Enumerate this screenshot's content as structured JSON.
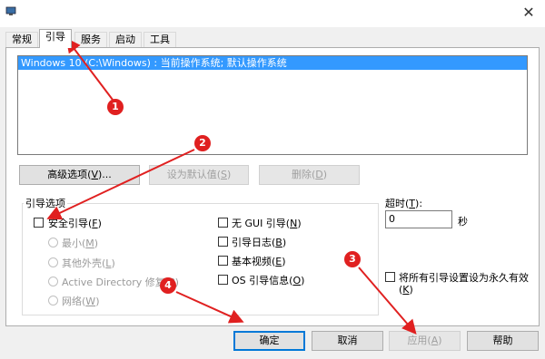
{
  "window": {
    "close_glyph": "✕",
    "app_icon": "system-config-icon"
  },
  "tabs": [
    {
      "label": "常规"
    },
    {
      "label": "引导"
    },
    {
      "label": "服务"
    },
    {
      "label": "启动"
    },
    {
      "label": "工具"
    }
  ],
  "os_list": {
    "selected_entry": "Windows 10 (C:\\Windows) : 当前操作系统; 默认操作系统"
  },
  "buttons": {
    "advanced_prefix": "高级选项(",
    "advanced_key": "V",
    "advanced_suffix": ")...",
    "set_default_prefix": "设为默认值(",
    "set_default_key": "S",
    "set_default_suffix": ")",
    "delete_prefix": "删除(",
    "delete_key": "D",
    "delete_suffix": ")"
  },
  "boot_options": {
    "group_label": "引导选项",
    "safe_boot": {
      "prefix": "安全引导(",
      "key": "F",
      "suffix": ")",
      "checked": false
    },
    "radios": [
      {
        "prefix": "最小(",
        "key": "M",
        "suffix": ")"
      },
      {
        "prefix": "其他外壳(",
        "key": "L",
        "suffix": ")"
      },
      {
        "prefix": "Active Directory 修复(",
        "key": "P",
        "suffix": ")"
      },
      {
        "prefix": "网络(",
        "key": "W",
        "suffix": ")"
      }
    ],
    "right_checks": [
      {
        "prefix": "无 GUI 引导(",
        "key": "N",
        "suffix": ")"
      },
      {
        "prefix": "引导日志(",
        "key": "B",
        "suffix": ")"
      },
      {
        "prefix": "基本视频(",
        "key": "E",
        "suffix": ")"
      },
      {
        "prefix": "OS 引导信息(",
        "key": "O",
        "suffix": ")"
      }
    ]
  },
  "timeout": {
    "label_prefix": "超时(",
    "label_key": "T",
    "label_suffix": "):",
    "value": "0",
    "unit": "秒"
  },
  "permanent": {
    "line1": "将所有引导设置设为永久有效",
    "line2_prefix": "(",
    "line2_key": "K",
    "line2_suffix": ")",
    "checked": false
  },
  "footer": {
    "ok": "确定",
    "cancel": "取消",
    "apply_prefix": "应用(",
    "apply_key": "A",
    "apply_suffix": ")",
    "help": "帮助"
  },
  "callouts": [
    "1",
    "2",
    "3",
    "4"
  ],
  "colors": {
    "accent": "#3399ff",
    "callout": "#e02020",
    "default_button_border": "#0078d7"
  }
}
